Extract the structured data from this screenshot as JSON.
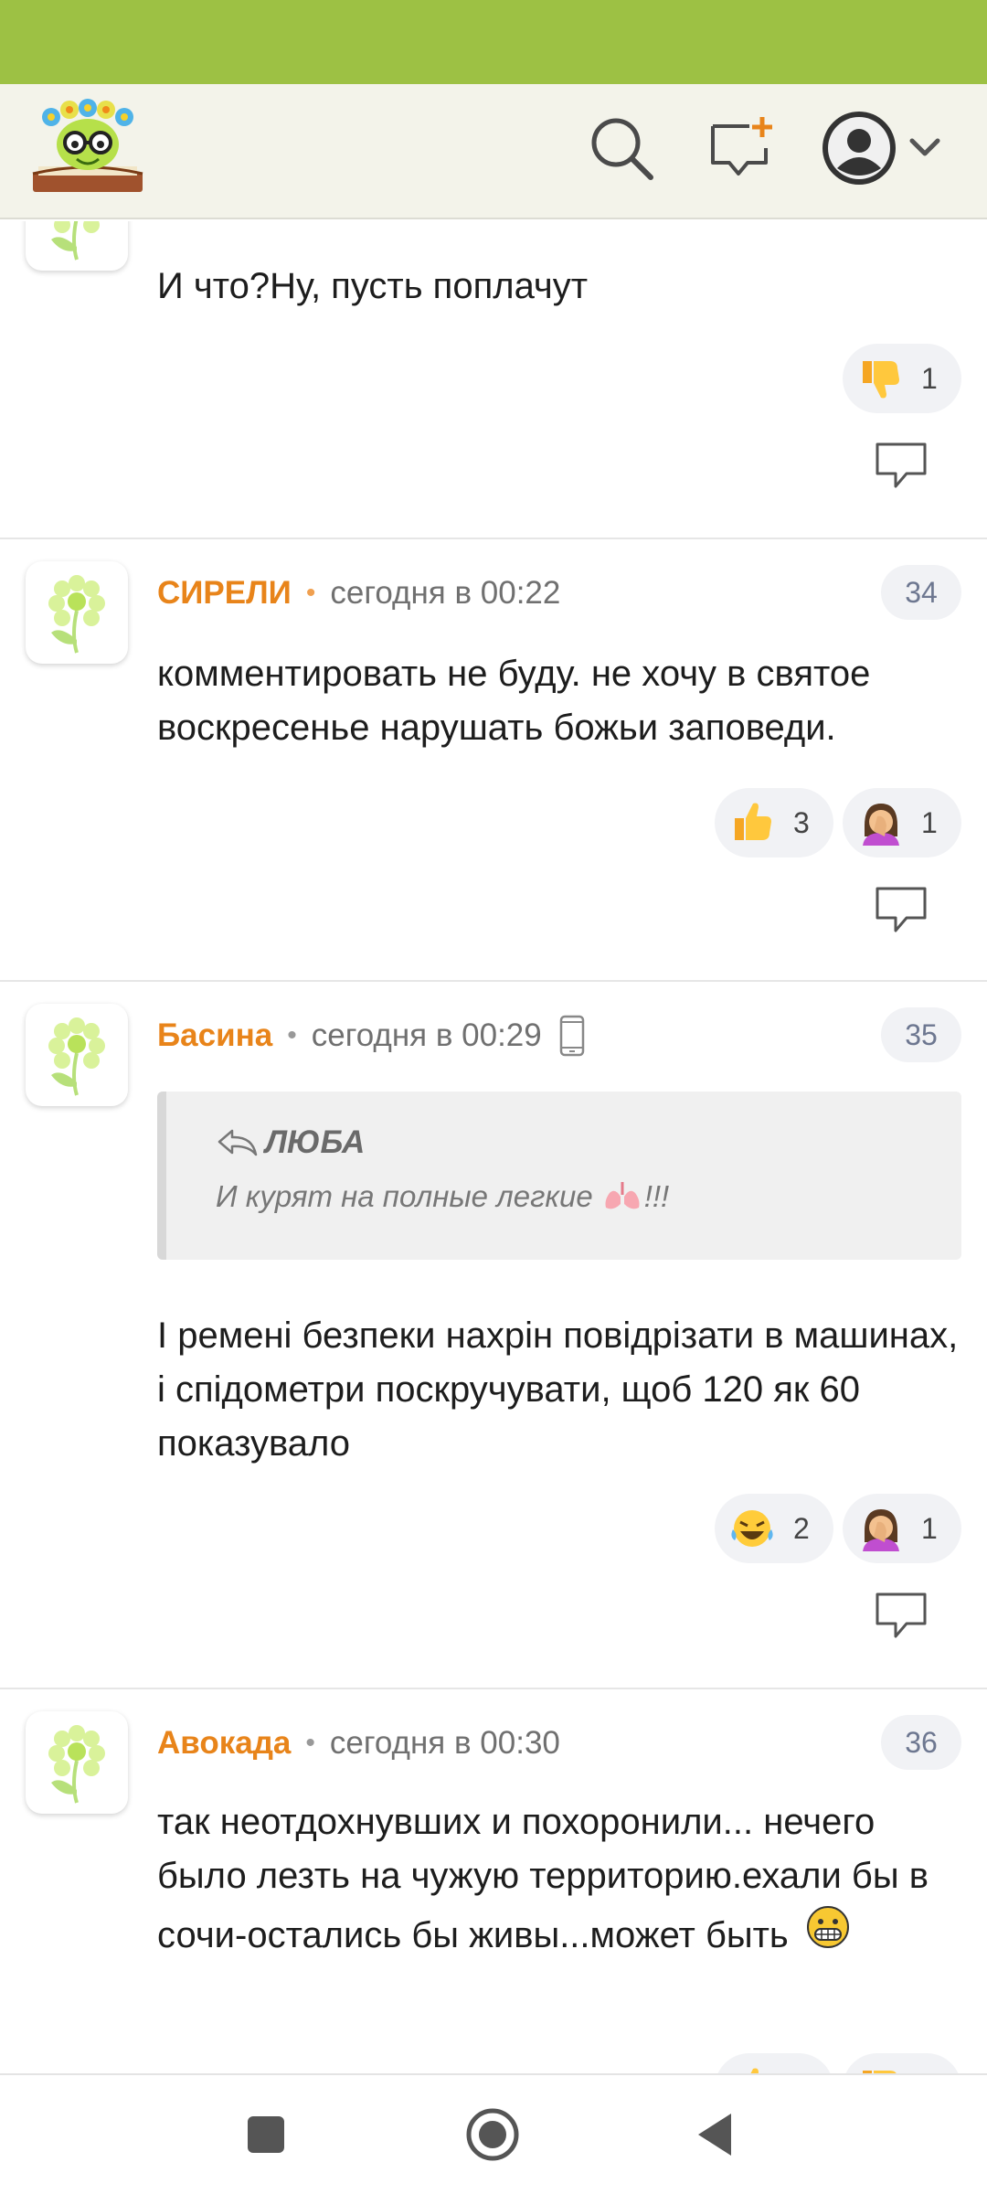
{
  "comments": [
    {
      "text": "И что?Ну, пусть поплачут",
      "reactions": [
        {
          "icon": "thumbs-down-emoji",
          "count": "1"
        }
      ]
    },
    {
      "author": "СИРЕЛИ",
      "time": "сегодня в 00:22",
      "number": "34",
      "text": "комментировать не буду. не хочу в святое воскресенье нарушать божьи заповеди.",
      "reactions": [
        {
          "icon": "thumbs-up-emoji",
          "count": "3"
        },
        {
          "icon": "facepalm-emoji",
          "count": "1"
        }
      ]
    },
    {
      "author": "Басина",
      "time": "сегодня в 00:29",
      "number": "35",
      "quote": {
        "author": "ЛЮБА",
        "text": "И курят на полные легкие",
        "suffix": "!!!"
      },
      "text": "І ремені безпеки нахрін повідрізати в машинах, і спідометри поскручувати, щоб 120 як 60 показувало",
      "reactions": [
        {
          "icon": "laughing-tears-emoji",
          "count": "2"
        },
        {
          "icon": "facepalm-emoji",
          "count": "1"
        }
      ]
    },
    {
      "author": "Авокада",
      "time": "сегодня в 00:30",
      "number": "36",
      "text": "так неотдохнувших и похоронили... нечего было лезть на чужую территорию.ехали бы в сочи-остались бы живы...может быть"
    }
  ],
  "colors": {
    "status_bar": "#9dc144",
    "accent": "#e8841a",
    "header_bg": "#f3f3ea"
  }
}
